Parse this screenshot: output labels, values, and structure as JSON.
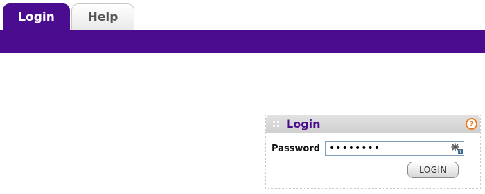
{
  "tabs": [
    {
      "label": "Login",
      "active": true
    },
    {
      "label": "Help",
      "active": false
    }
  ],
  "colors": {
    "brand_purple": "#4a0b8e",
    "help_orange": "#f07a1a"
  },
  "login_panel": {
    "title": "Login",
    "help_icon": "help-circle-icon",
    "help_glyph": "?",
    "password_label": "Password",
    "password_value": "••••••••",
    "key_icon": "password-key-icon",
    "submit_label": "LOGIN"
  }
}
